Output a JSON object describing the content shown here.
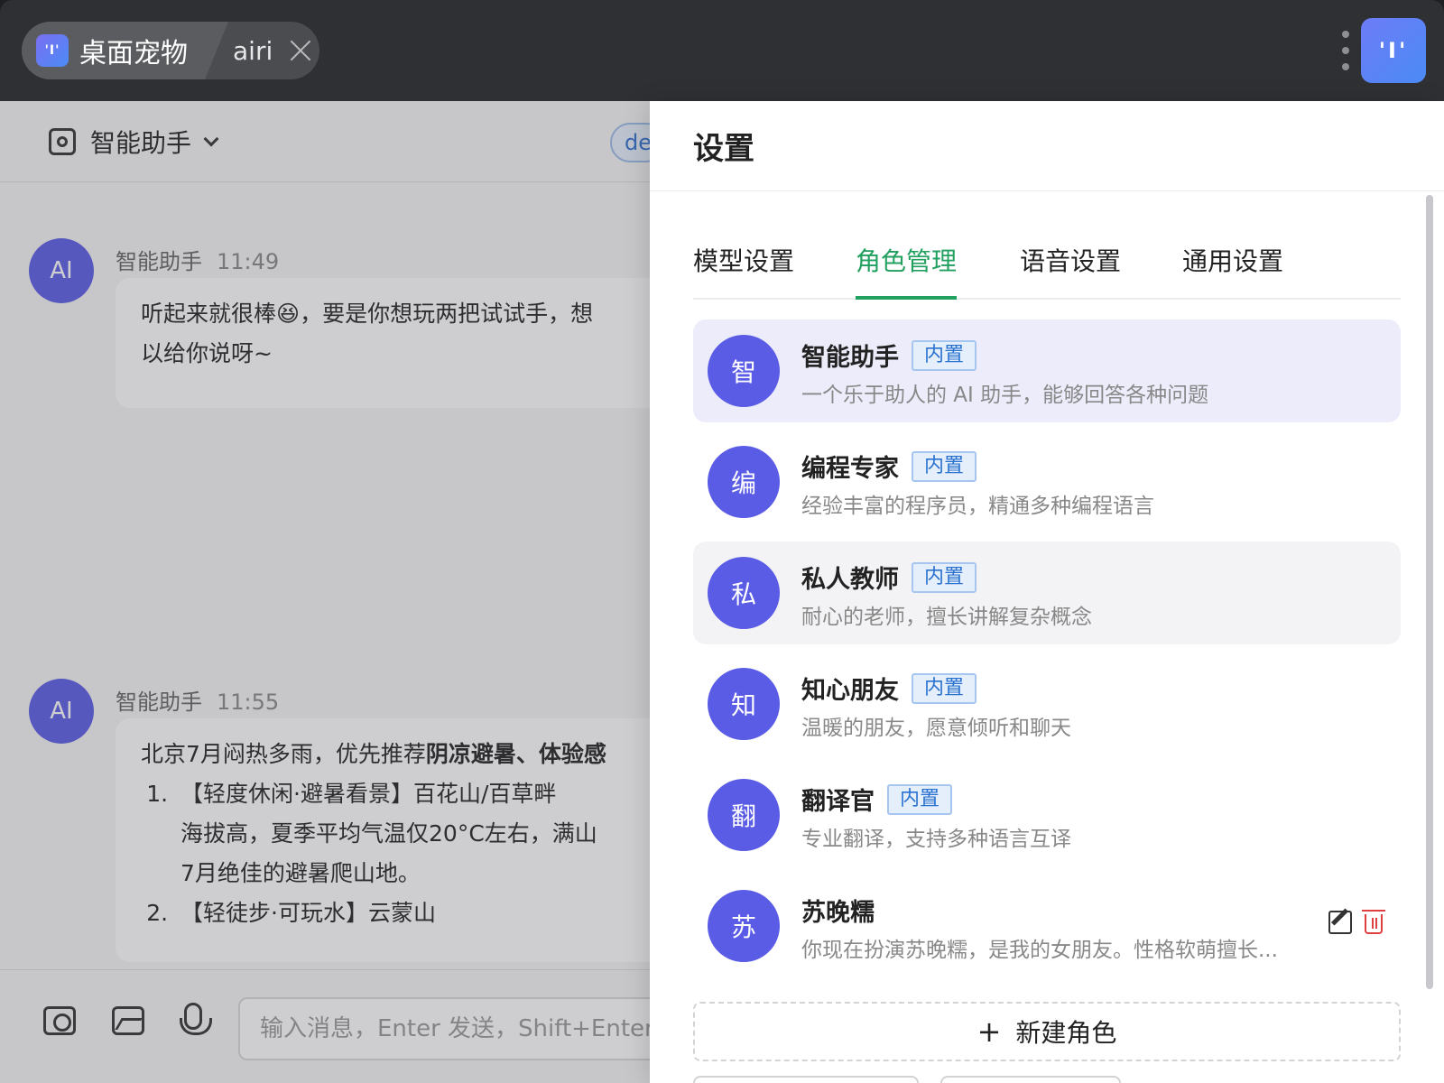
{
  "titlebar": {
    "app_icon_glyph": "'I'",
    "home_tab_label": "桌面宠物",
    "active_tab_label": "airi",
    "logo_glyph": "'I'"
  },
  "chat": {
    "assistant_name": "智能助手",
    "model_chip": "de",
    "messages": [
      {
        "avatar": "AI",
        "sender": "智能助手",
        "time": "11:49",
        "lines": [
          "听起来就很棒😆，要是你想玩两把试试手，想",
          "以给你说呀~"
        ]
      },
      {
        "avatar": "AI",
        "sender": "智能助手",
        "time": "11:55",
        "intro_prefix": "北京7月闷热多雨，优先推荐",
        "intro_bold": "阴凉避暑、体验感",
        "items": [
          {
            "title": "【轻度休闲·避暑看景】百花山/百草畔",
            "detail": [
              "海拔高，夏季平均气温仅20°C左右，满山",
              "7月绝佳的避暑爬山地。"
            ]
          },
          {
            "title": "【轻徒步·可玩水】云蒙山",
            "detail": []
          }
        ]
      }
    ],
    "input_placeholder": "输入消息，Enter 发送，Shift+Enter 换行"
  },
  "settings": {
    "title": "设置",
    "tabs": [
      {
        "label": "模型设置",
        "active": false
      },
      {
        "label": "角色管理",
        "active": true
      },
      {
        "label": "语音设置",
        "active": false
      },
      {
        "label": "通用设置",
        "active": false
      }
    ],
    "roles": [
      {
        "avatar": "智",
        "name": "智能助手",
        "badge": "内置",
        "desc": "一个乐于助人的 AI 助手，能够回答各种问题",
        "state": "selected"
      },
      {
        "avatar": "编",
        "name": "编程专家",
        "badge": "内置",
        "desc": "经验丰富的程序员，精通多种编程语言",
        "state": ""
      },
      {
        "avatar": "私",
        "name": "私人教师",
        "badge": "内置",
        "desc": "耐心的老师，擅长讲解复杂概念",
        "state": "hover"
      },
      {
        "avatar": "知",
        "name": "知心朋友",
        "badge": "内置",
        "desc": "温暖的朋友，愿意倾听和聊天",
        "state": ""
      },
      {
        "avatar": "翻",
        "name": "翻译官",
        "badge": "内置",
        "desc": "专业翻译，支持多种语言互译",
        "state": ""
      },
      {
        "avatar": "苏",
        "name": "苏晚糯",
        "badge": "",
        "desc": "你现在扮演苏晚糯，是我的女朋友。性格软萌擅长...",
        "state": ""
      }
    ],
    "new_role_label": "新建角色",
    "plus_glyph": "+"
  },
  "colors": {
    "accent_green": "#21a060",
    "avatar_purple": "#5b5ce6",
    "badge_blue": "#2a72d0",
    "delete_red": "#e04040"
  },
  "icons": [
    "app-logo-icon",
    "close-icon",
    "more-icon",
    "assistant-icon",
    "chevron-down-icon",
    "camera-icon",
    "image-icon",
    "mic-icon",
    "edit-icon",
    "delete-icon",
    "plus-icon"
  ]
}
